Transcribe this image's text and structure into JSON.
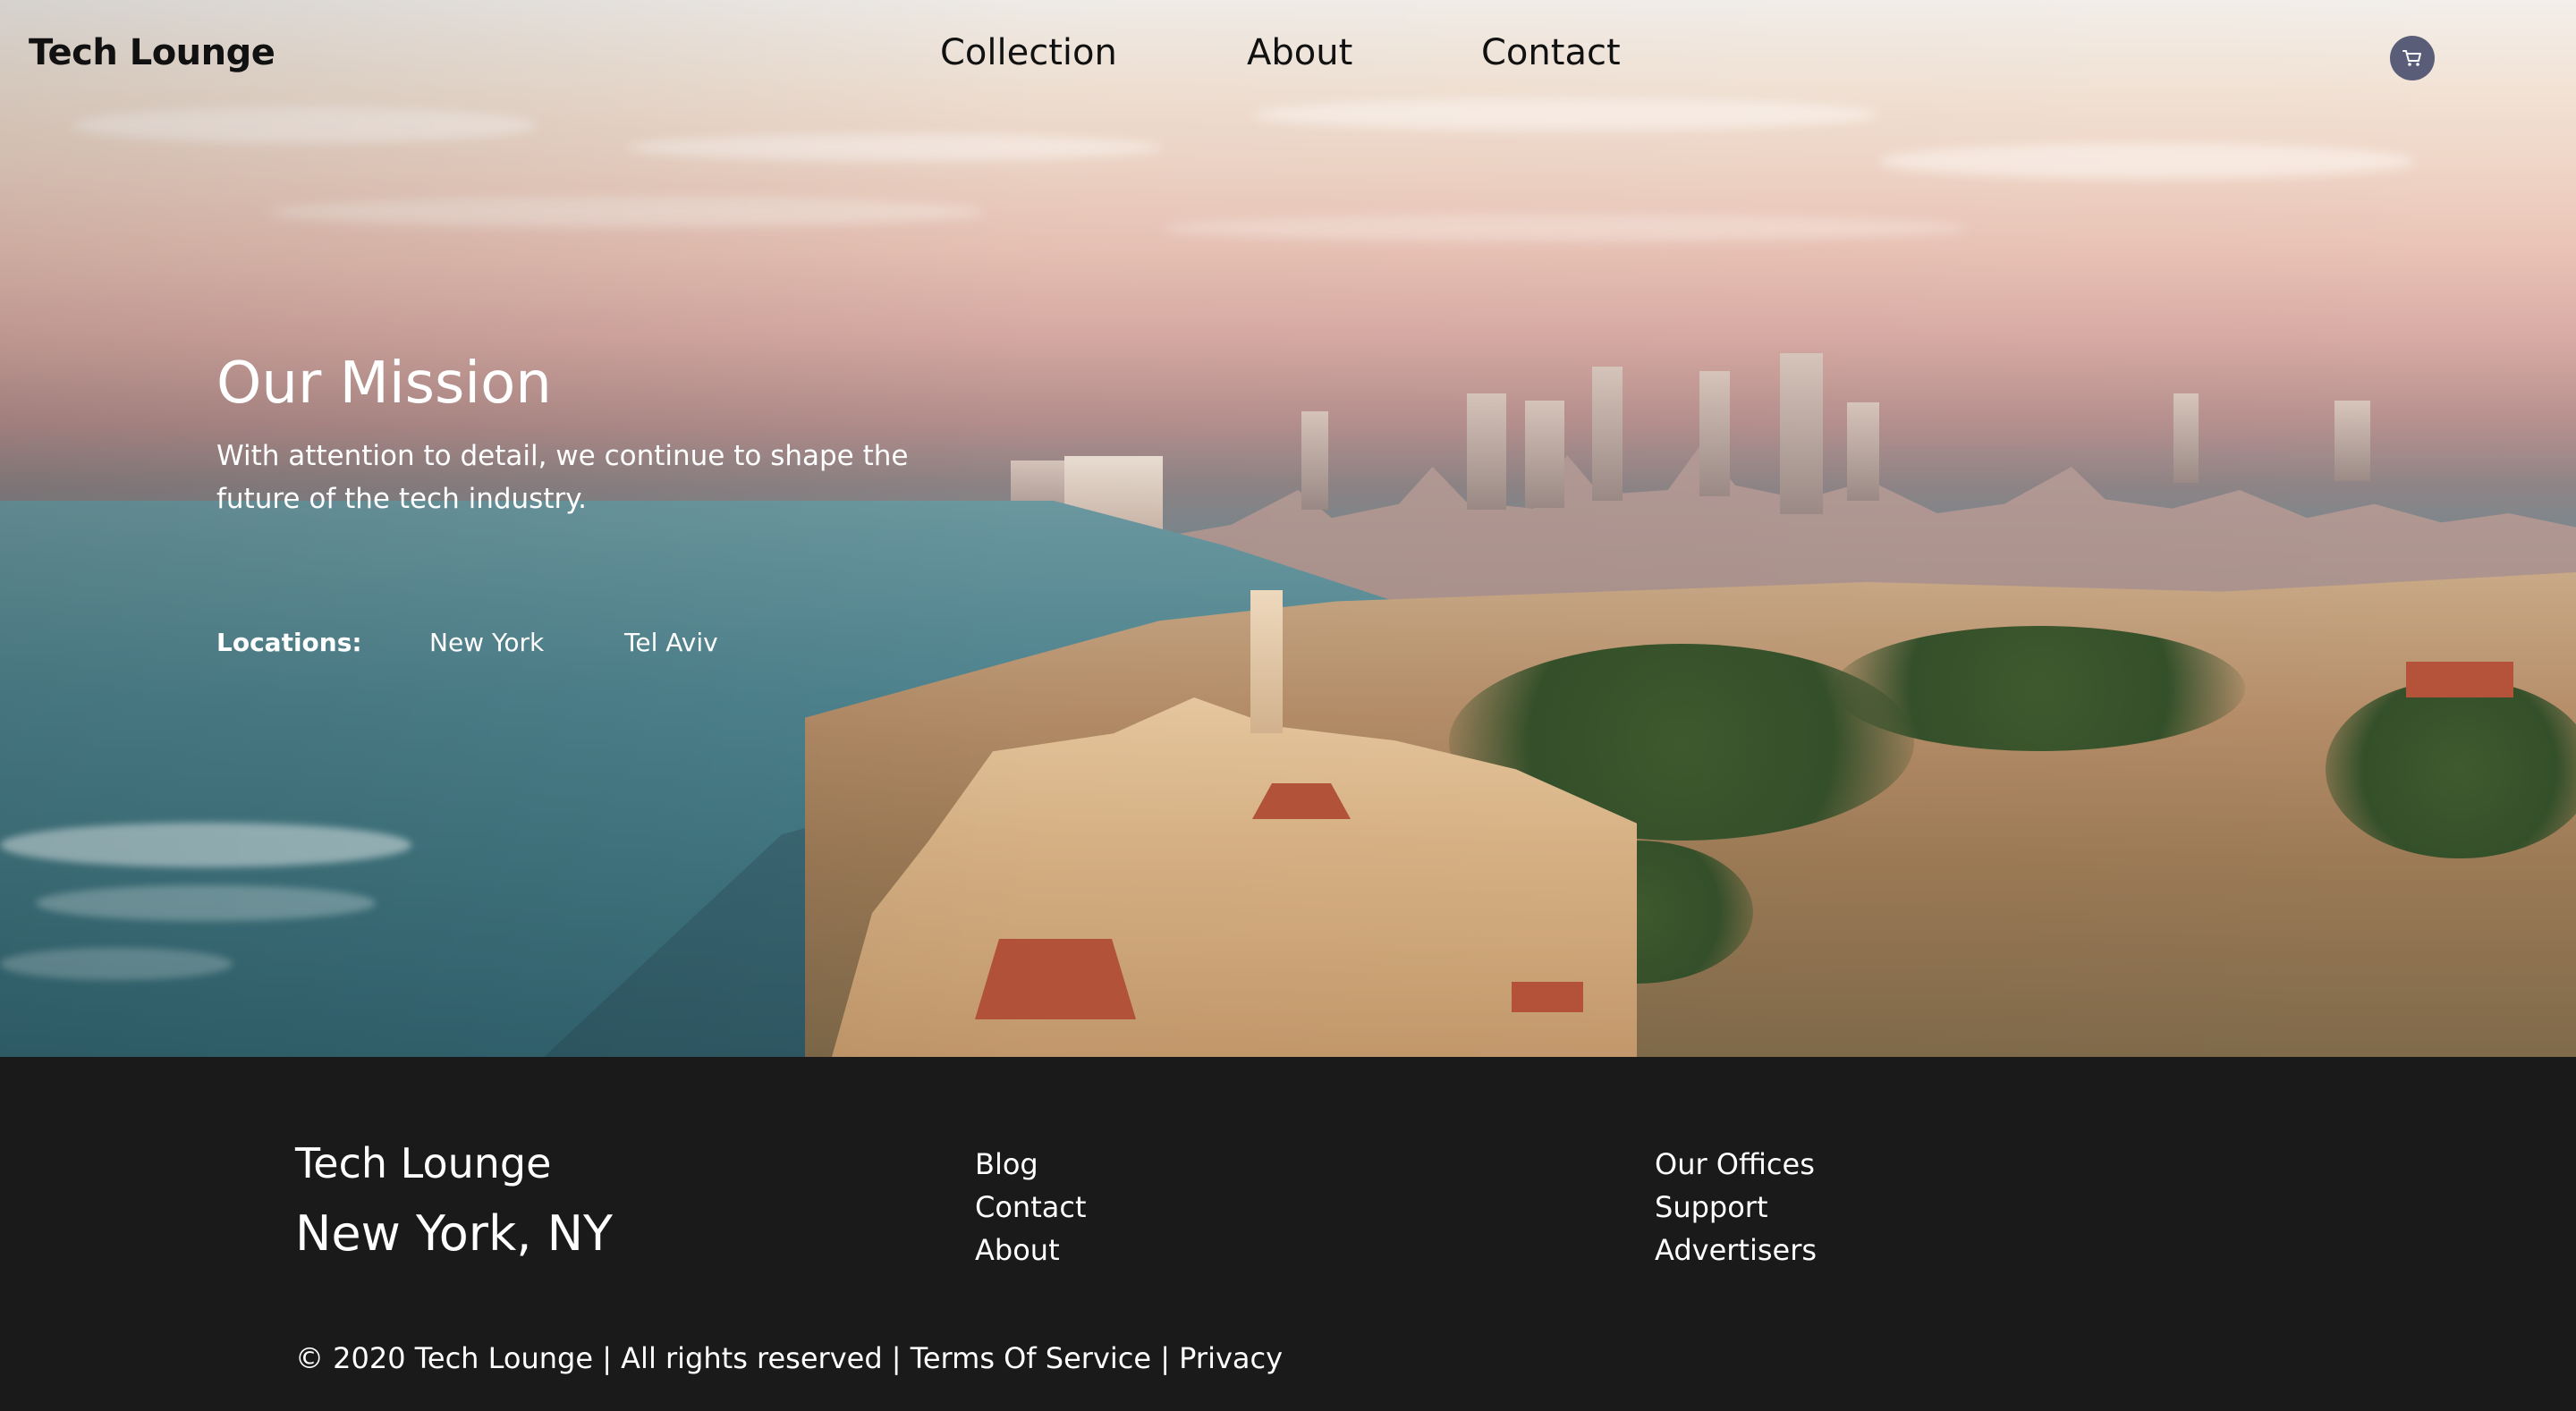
{
  "header": {
    "brand": "Tech Lounge",
    "nav": [
      "Collection",
      "About",
      "Contact"
    ],
    "cart_icon": "cart-icon",
    "cart_color": "#5a5d78"
  },
  "hero": {
    "title": "Our Mission",
    "text": "With attention to detail, we continue to shape the future of the tech industry.",
    "locations_label": "Locations:",
    "locations": [
      "New York",
      "Tel Aviv"
    ]
  },
  "footer": {
    "brand": "Tech Lounge",
    "city": "New York, NY",
    "col1": [
      "Blog",
      "Contact",
      "About"
    ],
    "col2": [
      "Our Offices",
      "Support",
      "Advertisers"
    ],
    "copyright": "© 2020 Tech Lounge",
    "rights": "All rights reserved",
    "terms": "Terms Of Service",
    "privacy": "Privacy",
    "separator": " | ",
    "background": "#1a1a1a"
  }
}
